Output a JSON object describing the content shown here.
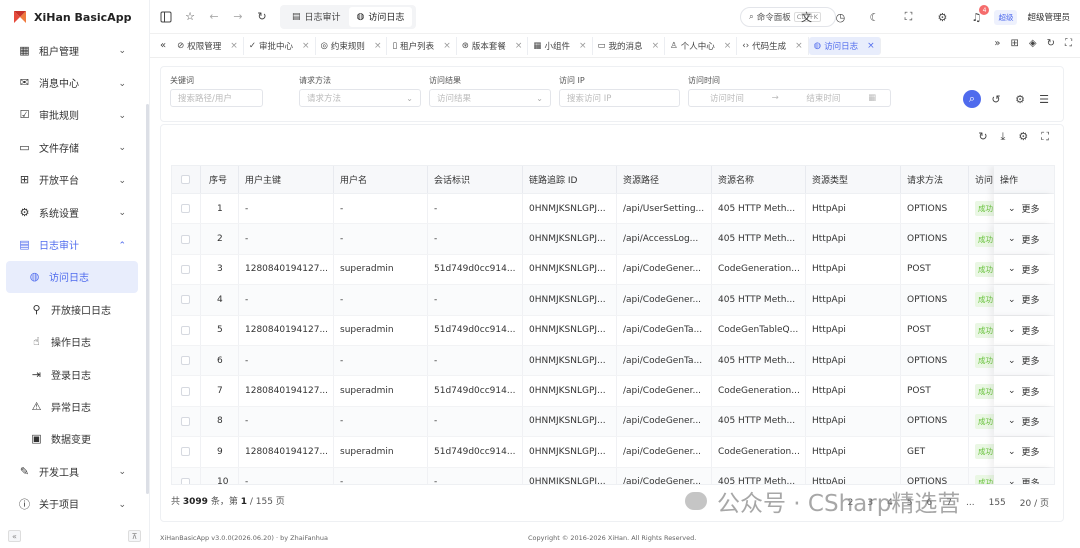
{
  "app": {
    "title": "XiHan BasicApp"
  },
  "sidebar": {
    "items": [
      {
        "label": "租户管理",
        "icon": "building-icon",
        "glyph": "▦",
        "chevron": "⌄"
      },
      {
        "label": "消息中心",
        "icon": "mail-icon",
        "glyph": "✉",
        "chevron": "⌄"
      },
      {
        "label": "审批规则",
        "icon": "clipboard-check-icon",
        "glyph": "☑",
        "chevron": "⌄"
      },
      {
        "label": "文件存储",
        "icon": "folder-icon",
        "glyph": "▭",
        "chevron": "⌄"
      },
      {
        "label": "开放平台",
        "icon": "grid-plus-icon",
        "glyph": "⊞",
        "chevron": "⌄"
      },
      {
        "label": "系统设置",
        "icon": "gear-icon",
        "glyph": "⚙",
        "chevron": "⌄"
      },
      {
        "label": "日志审计",
        "icon": "clipboard-icon",
        "glyph": "▤",
        "chevron": "⌃"
      }
    ],
    "sub_items": [
      {
        "label": "访问日志",
        "icon": "globe-icon",
        "glyph": "◍"
      },
      {
        "label": "开放接口日志",
        "icon": "plug-icon",
        "glyph": "⚲"
      },
      {
        "label": "操作日志",
        "icon": "pointer-icon",
        "glyph": "☝"
      },
      {
        "label": "登录日志",
        "icon": "login-icon",
        "glyph": "⇥"
      },
      {
        "label": "异常日志",
        "icon": "warning-icon",
        "glyph": "⚠"
      },
      {
        "label": "数据变更",
        "icon": "document-icon",
        "glyph": "▣"
      }
    ],
    "bottom_items": [
      {
        "label": "开发工具",
        "icon": "wrench-icon",
        "glyph": "✎",
        "chevron": "⌄"
      },
      {
        "label": "关于项目",
        "icon": "info-icon",
        "glyph": "ⓘ",
        "chevron": "⌄"
      }
    ],
    "collapse_glyph": "«",
    "pin_glyph": "⊼"
  },
  "header": {
    "breadcrumb": [
      {
        "label": "日志审计",
        "glyph": "▤"
      },
      {
        "label": "访问日志",
        "glyph": "◍"
      }
    ],
    "command_label": "命令面板",
    "command_shortcut": "Ctrl+K",
    "notification_count": "4",
    "role": "超级",
    "username": "超级管理员"
  },
  "tabs": [
    {
      "label": "权限管理",
      "glyph": "⊘"
    },
    {
      "label": "审批中心",
      "glyph": "✓"
    },
    {
      "label": "约束规则",
      "glyph": "◎"
    },
    {
      "label": "租户列表",
      "glyph": "▯"
    },
    {
      "label": "版本套餐",
      "glyph": "⊛"
    },
    {
      "label": "小组件",
      "glyph": "▦"
    },
    {
      "label": "我的消息",
      "glyph": "▭"
    },
    {
      "label": "个人中心",
      "glyph": "♙"
    },
    {
      "label": "代码生成",
      "glyph": "‹›"
    },
    {
      "label": "访问日志",
      "glyph": "◍"
    }
  ],
  "filter": {
    "keyword": {
      "label": "关键词",
      "placeholder": "搜索路径/用户"
    },
    "method": {
      "label": "请求方法",
      "placeholder": "请求方法"
    },
    "result": {
      "label": "访问结果",
      "placeholder": "访问结果"
    },
    "ip": {
      "label": "访问 IP",
      "placeholder": "搜索访问 IP"
    },
    "time": {
      "label": "访问时间",
      "start": "访问时间",
      "arrow": "→",
      "end": "结束时间"
    }
  },
  "table": {
    "columns": [
      "序号",
      "用户主键",
      "用户名",
      "会话标识",
      "链路追踪 ID",
      "资源路径",
      "资源名称",
      "资源类型",
      "请求方法",
      "访问",
      "操作"
    ],
    "rows": [
      {
        "no": "1",
        "uid": "-",
        "user": "-",
        "sid": "-",
        "trace": "0HNMJKSNLGPJ...",
        "path": "/api/UserSetting...",
        "name": "405 HTTP Meth...",
        "type": "HttpApi",
        "method": "OPTIONS",
        "status": "成功"
      },
      {
        "no": "2",
        "uid": "-",
        "user": "-",
        "sid": "-",
        "trace": "0HNMJKSNLGPJ...",
        "path": "/api/AccessLog...",
        "name": "405 HTTP Meth...",
        "type": "HttpApi",
        "method": "OPTIONS",
        "status": "成功"
      },
      {
        "no": "3",
        "uid": "1280840194127...",
        "user": "superadmin",
        "sid": "51d749d0cc914...",
        "trace": "0HNMJKSNLGPJ...",
        "path": "/api/CodeGener...",
        "name": "CodeGeneration...",
        "type": "HttpApi",
        "method": "POST",
        "status": "成功"
      },
      {
        "no": "4",
        "uid": "-",
        "user": "-",
        "sid": "-",
        "trace": "0HNMJKSNLGPJ...",
        "path": "/api/CodeGener...",
        "name": "405 HTTP Meth...",
        "type": "HttpApi",
        "method": "OPTIONS",
        "status": "成功"
      },
      {
        "no": "5",
        "uid": "1280840194127...",
        "user": "superadmin",
        "sid": "51d749d0cc914...",
        "trace": "0HNMJKSNLGPJ...",
        "path": "/api/CodeGenTa...",
        "name": "CodeGenTableQ...",
        "type": "HttpApi",
        "method": "POST",
        "status": "成功"
      },
      {
        "no": "6",
        "uid": "-",
        "user": "-",
        "sid": "-",
        "trace": "0HNMJKSNLGPJ...",
        "path": "/api/CodeGenTa...",
        "name": "405 HTTP Meth...",
        "type": "HttpApi",
        "method": "OPTIONS",
        "status": "成功"
      },
      {
        "no": "7",
        "uid": "1280840194127...",
        "user": "superadmin",
        "sid": "51d749d0cc914...",
        "trace": "0HNMJKSNLGPJ...",
        "path": "/api/CodeGener...",
        "name": "CodeGeneration...",
        "type": "HttpApi",
        "method": "POST",
        "status": "成功"
      },
      {
        "no": "8",
        "uid": "-",
        "user": "-",
        "sid": "-",
        "trace": "0HNMJKSNLGPJ...",
        "path": "/api/CodeGener...",
        "name": "405 HTTP Meth...",
        "type": "HttpApi",
        "method": "OPTIONS",
        "status": "成功"
      },
      {
        "no": "9",
        "uid": "1280840194127...",
        "user": "superadmin",
        "sid": "51d749d0cc914...",
        "trace": "0HNMJKSNLGPJ...",
        "path": "/api/CodeGener...",
        "name": "CodeGeneration...",
        "type": "HttpApi",
        "method": "GET",
        "status": "成功"
      },
      {
        "no": "10",
        "uid": "-",
        "user": "-",
        "sid": "-",
        "trace": "0HNMJKSNLGPJ...",
        "path": "/api/CodeGener...",
        "name": "405 HTTP Meth...",
        "type": "HttpApi",
        "method": "OPTIONS",
        "status": "成功"
      }
    ],
    "more_label": "更多"
  },
  "pagination": {
    "prefix": "共",
    "total": "3099",
    "unit": "条，第",
    "current": "1",
    "sep": "/ 155 页",
    "pages": [
      "2",
      "3",
      "4",
      "5",
      "6",
      "7",
      "...",
      "155",
      "20 / 页"
    ]
  },
  "footer": {
    "version": "XiHanBasicApp v3.0.0(2026.06.20) · by ZhaiFanhua",
    "copyright": "Copyright © 2016-2026 XiHan. All Rights Reserved."
  },
  "watermark": {
    "text": "公众号 · CSharp精选营"
  },
  "colors": {
    "accent": "#4f6bed",
    "success": "#67c23a",
    "badge": "#f56c6c"
  }
}
